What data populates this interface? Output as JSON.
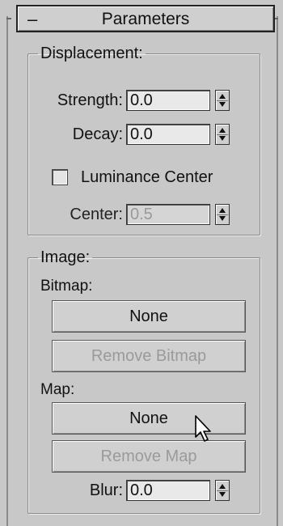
{
  "rollout": {
    "collapse_symbol": "–",
    "title": "Parameters"
  },
  "displacement": {
    "group_label": "Displacement:",
    "strength": {
      "label": "Strength:",
      "value": "0.0"
    },
    "decay": {
      "label": "Decay:",
      "value": "0.0"
    },
    "luminance_center": {
      "label": "Luminance Center",
      "checked": false
    },
    "center": {
      "label": "Center:",
      "value": "0.5",
      "enabled": false
    }
  },
  "image": {
    "group_label": "Image:",
    "bitmap_label": "Bitmap:",
    "bitmap_button": "None",
    "remove_bitmap_button": "Remove Bitmap",
    "map_label": "Map:",
    "map_button": "None",
    "remove_map_button": "Remove Map",
    "blur": {
      "label": "Blur:",
      "value": "0.0"
    }
  }
}
